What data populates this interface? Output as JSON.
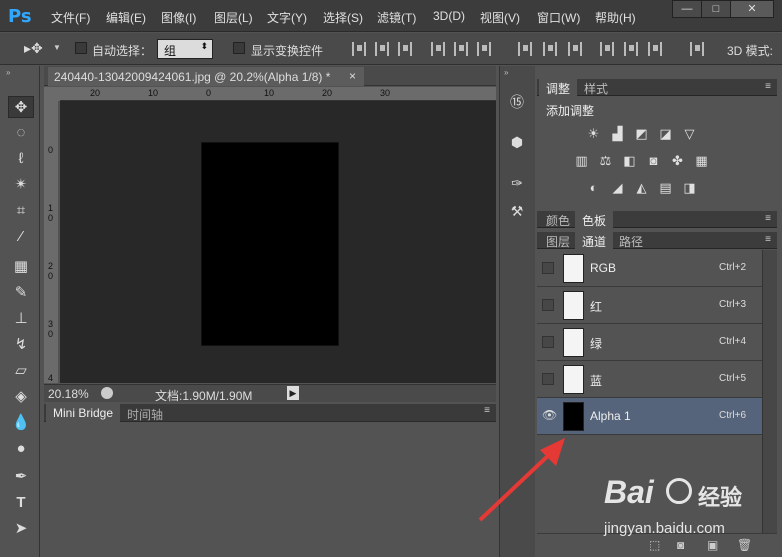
{
  "app": {
    "logo": "Ps"
  },
  "menu": [
    "文件(F)",
    "编辑(E)",
    "图像(I)",
    "图层(L)",
    "文字(Y)",
    "选择(S)",
    "滤镜(T)",
    "3D(D)",
    "视图(V)",
    "窗口(W)",
    "帮助(H)"
  ],
  "window_controls": {
    "minimize": "—",
    "maximize": "□",
    "close": "✕"
  },
  "options": {
    "auto_select_label": "自动选择：",
    "auto_select_value": "组",
    "show_transform_label": "显示变换控件",
    "mode_label": "3D 模式:"
  },
  "document": {
    "tab_title": "240440-13042009424061.jpg @ 20.2%(Alpha 1/8) *",
    "tab_close": "×",
    "zoom": "20.18%",
    "doc_size": "文档:1.90M/1.90M",
    "ruler_top": [
      "20",
      "10",
      "0",
      "10",
      "20",
      "30"
    ],
    "ruler_left": [
      "1",
      "0",
      "1",
      "0",
      "2",
      "0",
      "3",
      "0",
      "4"
    ]
  },
  "bottom_panel": {
    "tabs": [
      "Mini Bridge",
      "时间轴"
    ]
  },
  "adjustments_panel": {
    "tabs": [
      "调整",
      "样式"
    ],
    "title": "添加调整",
    "icons": [
      "brightness-icon",
      "levels-icon",
      "curves-icon",
      "exposure-icon",
      "vibrance-icon",
      "hue-saturation-icon",
      "color-balance-icon",
      "black-white-icon",
      "photo-filter-icon",
      "channel-mixer-icon",
      "color-lookup-icon",
      "invert-icon",
      "posterize-icon",
      "threshold-icon",
      "gradient-map-icon",
      "selective-color-icon"
    ]
  },
  "swatch_panel": {
    "tabs": [
      "颜色",
      "色板"
    ]
  },
  "channels_panel": {
    "tabs": [
      "图层",
      "通道",
      "路径"
    ],
    "channels": [
      {
        "name": "RGB",
        "shortcut": "Ctrl+2"
      },
      {
        "name": "红",
        "shortcut": "Ctrl+3"
      },
      {
        "name": "绿",
        "shortcut": "Ctrl+4"
      },
      {
        "name": "蓝",
        "shortcut": "Ctrl+5"
      },
      {
        "name": "Alpha 1",
        "shortcut": "Ctrl+6"
      }
    ]
  },
  "watermark": {
    "brand": "Bai",
    "brand2": "经验",
    "url": "jingyan.baidu.com"
  },
  "colors": {
    "accent": "#31a8ff",
    "selected_row": "#55647a",
    "annotation_arrow": "#e53935"
  }
}
